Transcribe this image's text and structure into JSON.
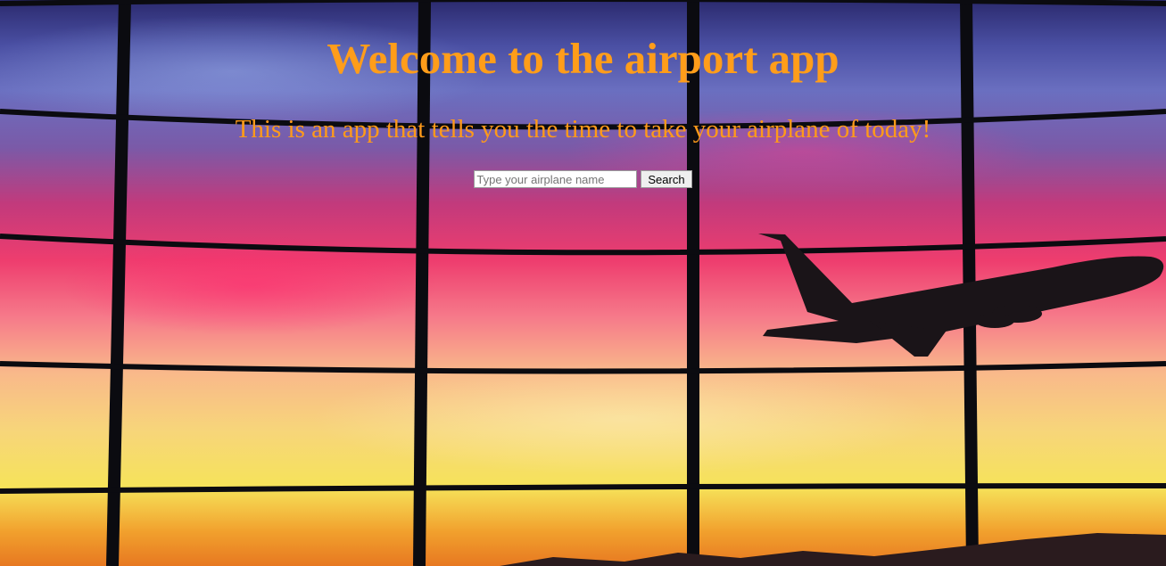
{
  "header": {
    "title": "Welcome to the airport app",
    "subtitle": "This is an app that tells you the time to take your airplane of today!"
  },
  "search": {
    "placeholder": "Type your airplane name",
    "value": "",
    "button_label": "Search"
  },
  "colors": {
    "heading": "#ff9d1a",
    "subtitle": "#ff9a1a"
  },
  "background": {
    "icon": "airport-window-sunset-airplane-image"
  }
}
